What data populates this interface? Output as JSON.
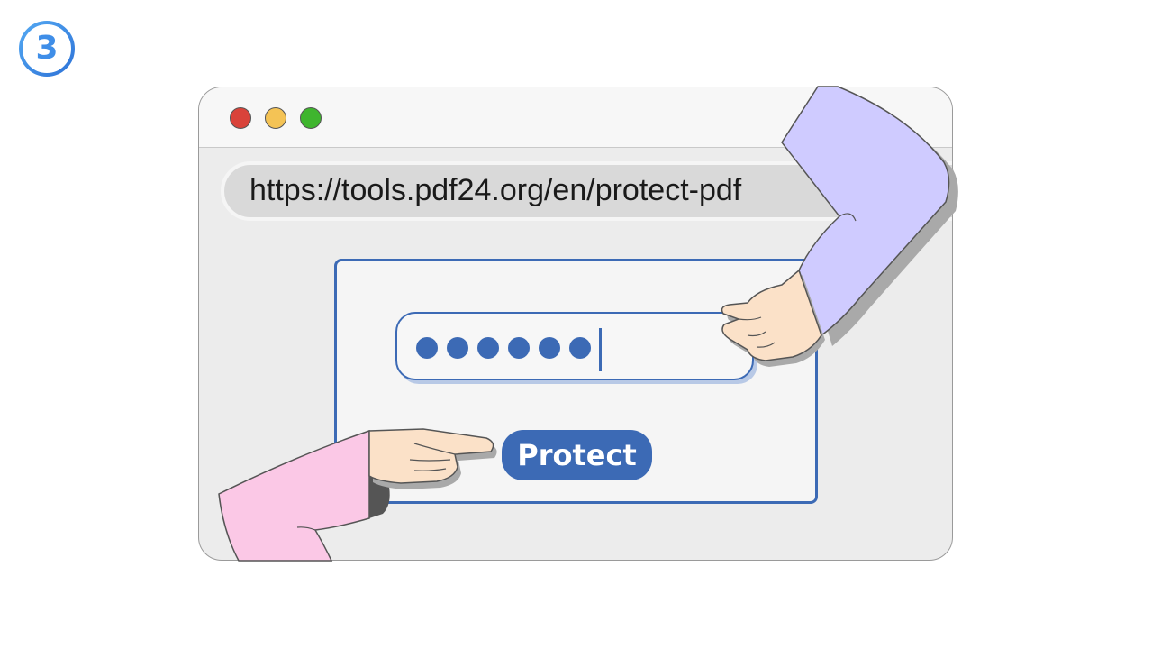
{
  "step": {
    "number": "3",
    "color": "#3f8ee8"
  },
  "browser": {
    "url": "https://tools.pdf24.org/en/protect-pdf",
    "window_buttons": [
      {
        "name": "close",
        "color": "#d9433a"
      },
      {
        "name": "minimize",
        "color": "#f4c355"
      },
      {
        "name": "maximize",
        "color": "#3fb52e"
      }
    ]
  },
  "dialog": {
    "password_masked_count": 6,
    "button_label": "Protect",
    "accent_color": "#3c6ab5"
  },
  "illustration": {
    "right_hand": "hand-typing-password",
    "left_hand": "hand-pointing-at-protect-button",
    "right_sleeve_color": "#cfcbff",
    "left_sleeve_color": "#fbc8e6"
  }
}
